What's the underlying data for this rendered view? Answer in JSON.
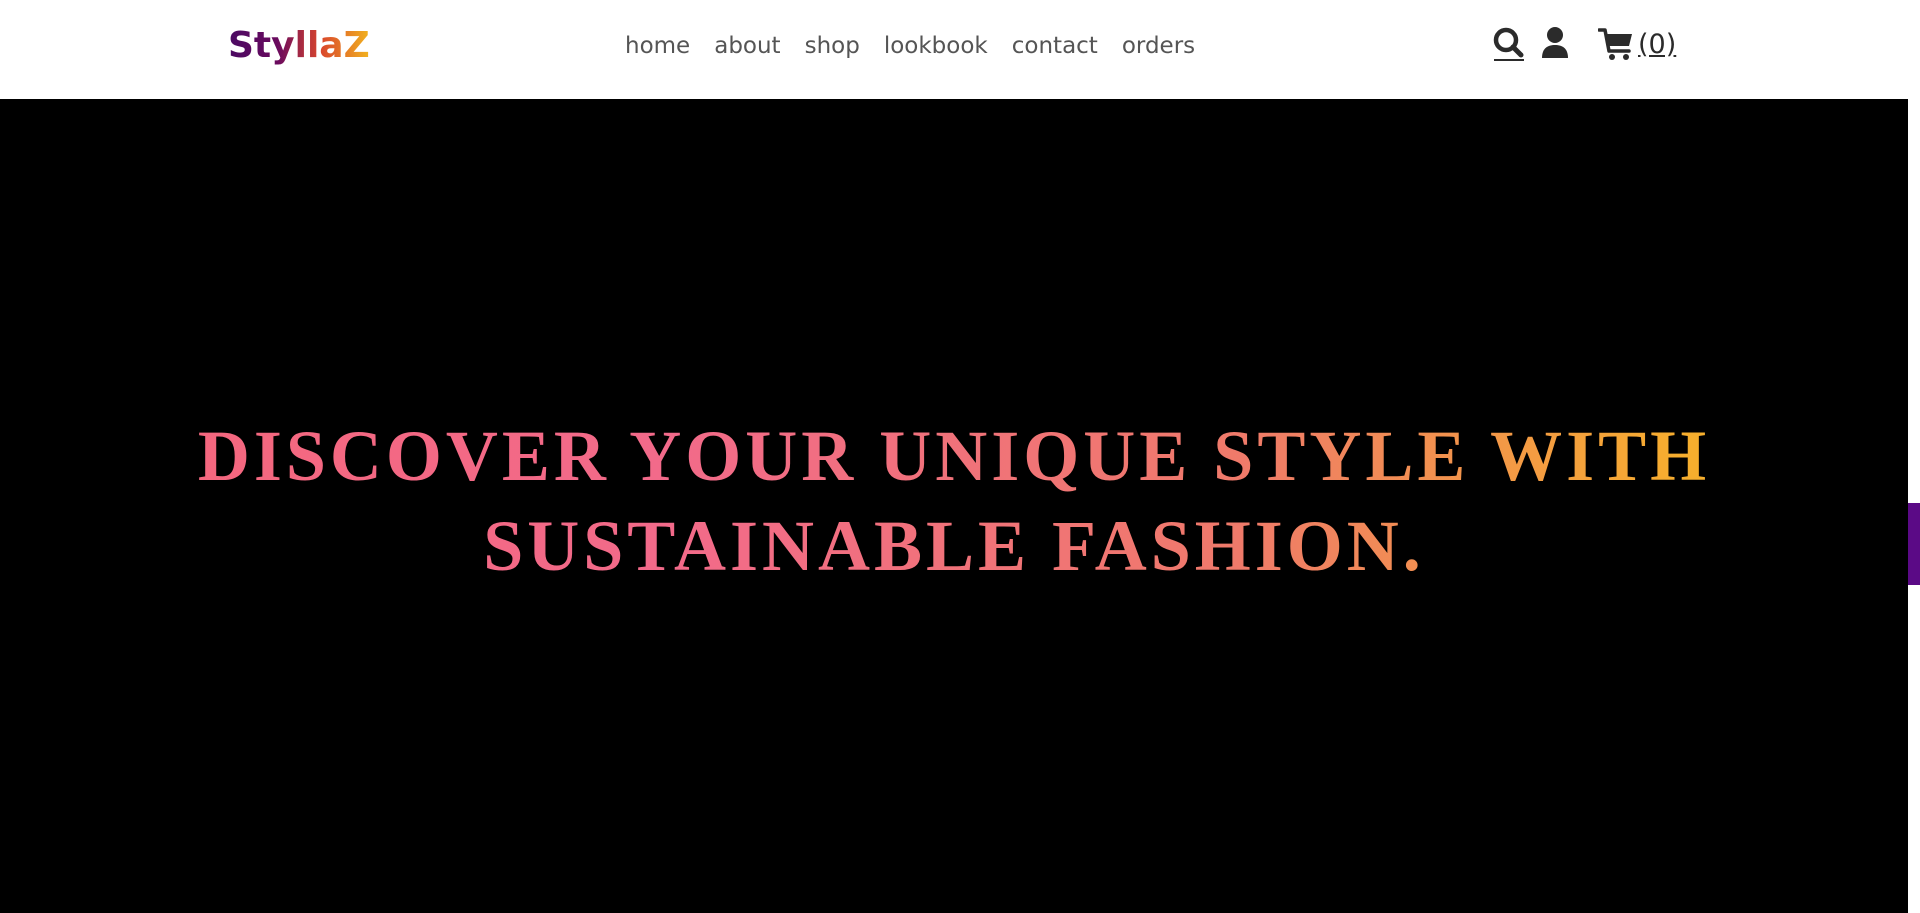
{
  "header": {
    "logo": "StyllaZ",
    "nav": [
      {
        "label": "home"
      },
      {
        "label": "about"
      },
      {
        "label": "shop"
      },
      {
        "label": "lookbook"
      },
      {
        "label": "contact"
      },
      {
        "label": "orders"
      }
    ],
    "icons": {
      "search": "search-icon",
      "user": "user-icon",
      "cart": "cart-icon"
    },
    "cart_count": "(0)"
  },
  "hero": {
    "title": "DISCOVER YOUR UNIQUE STYLE WITH SUSTAINABLE FASHION."
  },
  "colors": {
    "logo_gradient_start": "#4a0a63",
    "logo_gradient_end": "#f2b41f",
    "hero_background": "#000000",
    "hero_gradient_start": "#f5667a",
    "hero_gradient_end": "#f8bd24",
    "side_tab": "#5b0a86",
    "nav_text": "#555555"
  }
}
